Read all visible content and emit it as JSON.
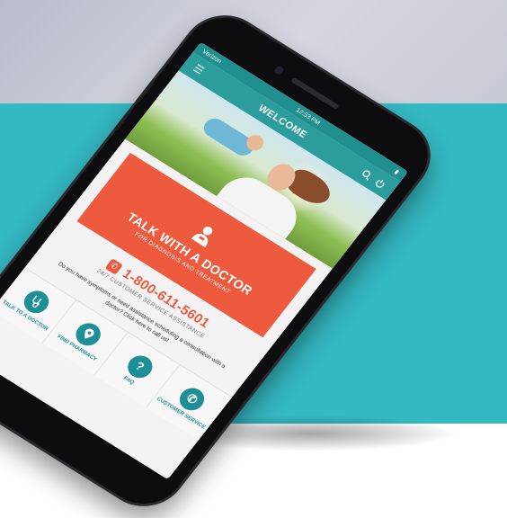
{
  "status_bar": {
    "carrier": "Verizon",
    "time": "12:53 PM"
  },
  "app_bar": {
    "title": "WELCOME"
  },
  "banner": {
    "title": "TALK WITH A DOCTOR",
    "subtitle": "FOR DIAGNOSIS AND TREATMENT"
  },
  "contact": {
    "phone": "1-800-611-5601",
    "subtitle": "24/7 CUSTOMER SERVICE ASSISTANCE",
    "description": "Do you have symptoms or need assistance scheduling a consultation with a doctor? Click here to call us!"
  },
  "tiles": [
    {
      "label": "TALK TO A DOCTOR",
      "icon": "stethoscope-icon"
    },
    {
      "label": "FIND PHARMACY",
      "icon": "location-pin-icon"
    },
    {
      "label": "FAQ",
      "icon": "question-icon"
    },
    {
      "label": "CUSTOMER SERVICE",
      "icon": "phone-icon"
    }
  ],
  "colors": {
    "teal_background": "#34b8c2",
    "app_teal": "#2a9d9c",
    "accent_orange": "#ee5a3d",
    "tile_icon": "#1f8f97"
  }
}
